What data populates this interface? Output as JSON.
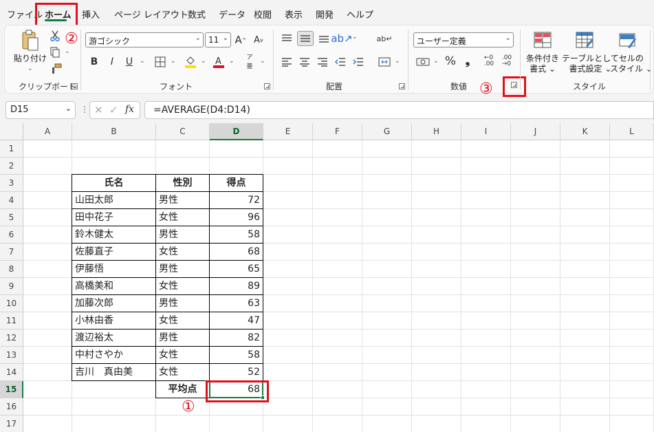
{
  "tabs": [
    "ファイル",
    "ホーム",
    "挿入",
    "ページ レイアウト",
    "数式",
    "データ",
    "校閲",
    "表示",
    "開発",
    "ヘルプ"
  ],
  "ribbon": {
    "clipboard": {
      "paste": "貼り付け",
      "label": "クリップボード"
    },
    "font": {
      "name": "游ゴシック",
      "size": "11",
      "label": "フォント",
      "bold": "B",
      "italic": "I",
      "underline": "U"
    },
    "alignment": {
      "label": "配置"
    },
    "number": {
      "format": "ユーザー定義",
      "label": "数値",
      "percent": "%",
      "comma": "❟"
    },
    "styles": {
      "conditional": [
        "条件付き",
        "書式 ⌄"
      ],
      "table": [
        "テーブルとして",
        "書式設定 ⌄"
      ],
      "cell": [
        "セルの",
        "スタイル ⌄"
      ],
      "label": "スタイル"
    }
  },
  "formula_bar": {
    "name_box": "D15",
    "formula": "=AVERAGE(D4:D14)",
    "fx": "fx"
  },
  "columns": [
    "A",
    "B",
    "C",
    "D",
    "E",
    "F",
    "G",
    "H",
    "I",
    "J",
    "K",
    "L"
  ],
  "rows": [
    "1",
    "2",
    "3",
    "4",
    "5",
    "6",
    "7",
    "8",
    "9",
    "10",
    "11",
    "12",
    "13",
    "14",
    "15",
    "16",
    "17"
  ],
  "table": {
    "headers": [
      "氏名",
      "性別",
      "得点"
    ],
    "rows": [
      [
        "山田太郎",
        "男性",
        "72"
      ],
      [
        "田中花子",
        "女性",
        "96"
      ],
      [
        "鈴木健太",
        "男性",
        "58"
      ],
      [
        "佐藤直子",
        "女性",
        "68"
      ],
      [
        "伊藤悟",
        "男性",
        "65"
      ],
      [
        "高橋美和",
        "女性",
        "89"
      ],
      [
        "加藤次郎",
        "男性",
        "63"
      ],
      [
        "小林由香",
        "女性",
        "47"
      ],
      [
        "渡辺裕太",
        "男性",
        "82"
      ],
      [
        "中村さやか",
        "女性",
        "58"
      ],
      [
        "吉川　真由美",
        "女性",
        "52"
      ]
    ],
    "average_label": "平均点",
    "average_value": "68"
  },
  "markers": {
    "one": "①",
    "two": "②",
    "three": "③"
  },
  "colors": {
    "accent": "#107c41",
    "annotation": "#e0101a"
  }
}
